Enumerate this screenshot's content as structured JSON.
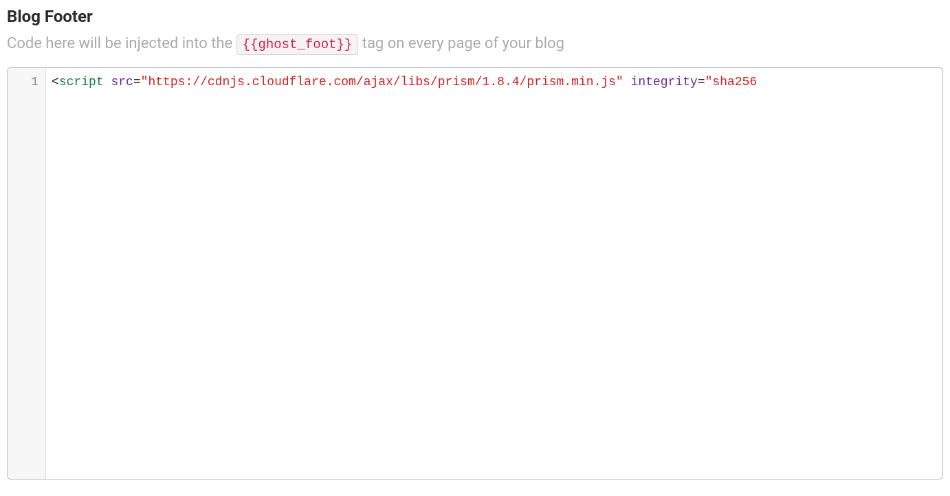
{
  "header": {
    "title": "Blog Footer",
    "desc_pre": "Code here will be injected into the ",
    "tag_label": "{{ghost_foot}}",
    "desc_post": " tag on every page of your blog"
  },
  "editor": {
    "lines": [
      {
        "n": "1",
        "tokens": [
          {
            "cls": "tok-punct",
            "t": "<"
          },
          {
            "cls": "tok-tag",
            "t": "script"
          },
          {
            "cls": "",
            "t": " "
          },
          {
            "cls": "tok-attr",
            "t": "src"
          },
          {
            "cls": "tok-eq",
            "t": "="
          },
          {
            "cls": "tok-str",
            "t": "\"https://cdnjs.cloudflare.com/ajax/libs/prism/1.8.4/prism.min.js\""
          },
          {
            "cls": "",
            "t": " "
          },
          {
            "cls": "tok-attr",
            "t": "integrity"
          },
          {
            "cls": "tok-eq",
            "t": "="
          },
          {
            "cls": "tok-str",
            "t": "\"sha256"
          }
        ]
      }
    ]
  }
}
